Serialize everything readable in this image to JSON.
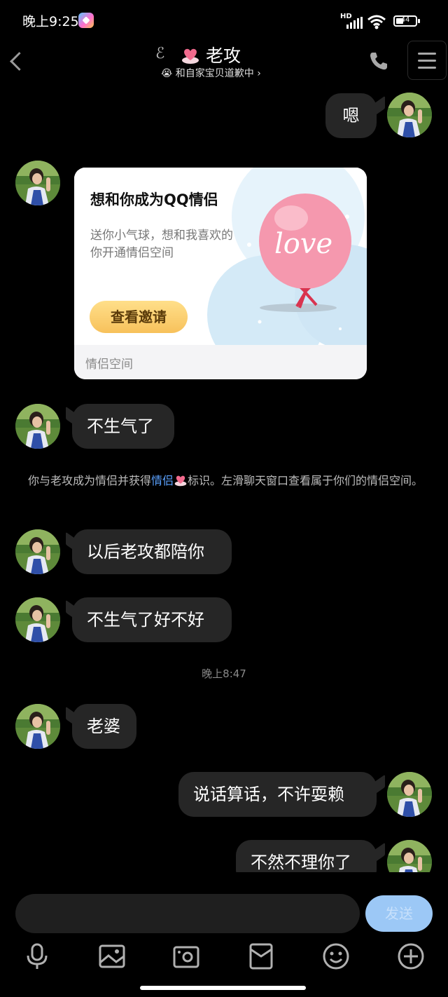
{
  "status_bar": {
    "time": "晚上9:25",
    "network": "HD",
    "battery": "44"
  },
  "header": {
    "contact_name": "老攻",
    "contact_status": "😭 和自家宝贝道歉中 ›"
  },
  "messages": [
    {
      "side": "right",
      "text": "嗯"
    },
    {
      "side": "left",
      "type": "card"
    },
    {
      "side": "left",
      "text": "不生气了"
    },
    {
      "side": "left",
      "text": "以后老攻都陪你"
    },
    {
      "side": "left",
      "text": "不生气了好不好"
    },
    {
      "side": "left",
      "text": "老婆"
    },
    {
      "side": "right",
      "text": "说话算话，不许耍赖"
    },
    {
      "side": "right",
      "text": "不然不理你了"
    }
  ],
  "card": {
    "title": "想和你成为QQ情侣",
    "description": "送你小气球，想和我喜欢的你开通情侣空间",
    "button": "查看邀请",
    "balloon_text": "love",
    "footer": "情侣空间"
  },
  "system_notice": {
    "before": "你与老攻成为情侣并获得",
    "highlight": "情侣",
    "after": "标识。左滑聊天窗口查看属于你们的情侣空间。"
  },
  "timestamp": "晚上8:47",
  "composer": {
    "send_label": "发送"
  },
  "toolbar": [
    "microphone-icon",
    "image-icon",
    "camera-icon",
    "red-packet-icon",
    "emoji-icon",
    "plus-icon"
  ],
  "colors": {
    "bubble": "#262626",
    "background": "#000000",
    "send_button": "#9cc8f6",
    "highlight": "#5ba2ff"
  }
}
